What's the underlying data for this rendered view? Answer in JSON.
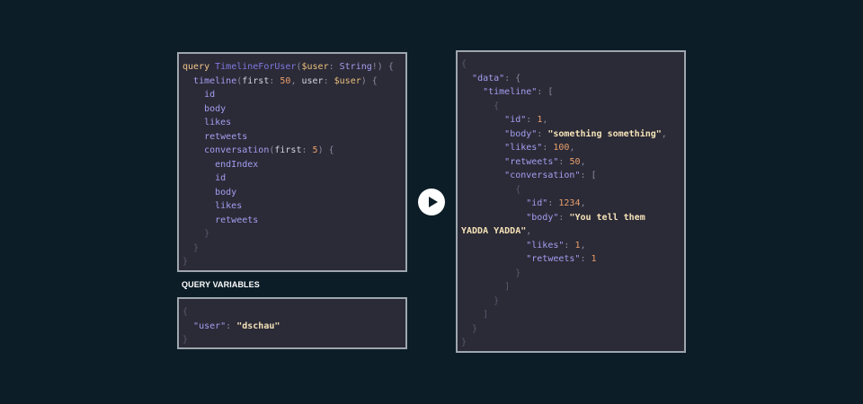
{
  "query": {
    "lines": [
      [
        [
          "kw",
          "query"
        ],
        [
          "plain",
          " "
        ],
        [
          "def",
          "TimelineForUser"
        ],
        [
          "punc",
          "("
        ],
        [
          "var",
          "$user"
        ],
        [
          "punc",
          ": "
        ],
        [
          "type",
          "String"
        ],
        [
          "punc",
          "!) {"
        ]
      ],
      [
        [
          "plain",
          "  "
        ],
        [
          "field",
          "timeline"
        ],
        [
          "punc",
          "("
        ],
        [
          "plain",
          "first"
        ],
        [
          "punc",
          ": "
        ],
        [
          "num",
          "50"
        ],
        [
          "punc",
          ", "
        ],
        [
          "plain",
          "user"
        ],
        [
          "punc",
          ": "
        ],
        [
          "var",
          "$user"
        ],
        [
          "punc",
          ") {"
        ]
      ],
      [
        [
          "plain",
          "    "
        ],
        [
          "field",
          "id"
        ]
      ],
      [
        [
          "plain",
          "    "
        ],
        [
          "field",
          "body"
        ]
      ],
      [
        [
          "plain",
          "    "
        ],
        [
          "field",
          "likes"
        ]
      ],
      [
        [
          "plain",
          "    "
        ],
        [
          "field",
          "retweets"
        ]
      ],
      [
        [
          "plain",
          "    "
        ],
        [
          "field",
          "conversation"
        ],
        [
          "punc",
          "("
        ],
        [
          "plain",
          "first"
        ],
        [
          "punc",
          ": "
        ],
        [
          "num",
          "5"
        ],
        [
          "punc",
          ") {"
        ]
      ],
      [
        [
          "plain",
          "      "
        ],
        [
          "field",
          "endIndex"
        ]
      ],
      [
        [
          "plain",
          "      "
        ],
        [
          "field",
          "id"
        ]
      ],
      [
        [
          "plain",
          "      "
        ],
        [
          "field",
          "body"
        ]
      ],
      [
        [
          "plain",
          "      "
        ],
        [
          "field",
          "likes"
        ]
      ],
      [
        [
          "plain",
          "      "
        ],
        [
          "field",
          "retweets"
        ]
      ],
      [
        [
          "plain",
          "    "
        ],
        [
          "dim",
          "}"
        ]
      ],
      [
        [
          "plain",
          "  "
        ],
        [
          "dim",
          "}"
        ]
      ],
      [
        [
          "dim",
          "}"
        ]
      ]
    ]
  },
  "variables": {
    "label": "QUERY VARIABLES",
    "lines": [
      [
        [
          "dim",
          "{"
        ]
      ],
      [
        [
          "plain",
          "  "
        ],
        [
          "key",
          "\"user\""
        ],
        [
          "punc",
          ": "
        ],
        [
          "str",
          "\"dschau\""
        ]
      ],
      [
        [
          "dim",
          "}"
        ]
      ]
    ]
  },
  "run_button": {
    "icon": "play-icon"
  },
  "result": {
    "lines": [
      [
        [
          "dim",
          "{"
        ]
      ],
      [
        [
          "plain",
          "  "
        ],
        [
          "key",
          "\"data\""
        ],
        [
          "punc",
          ": {"
        ]
      ],
      [
        [
          "plain",
          "    "
        ],
        [
          "key",
          "\"timeline\""
        ],
        [
          "punc",
          ": ["
        ]
      ],
      [
        [
          "plain",
          "      "
        ],
        [
          "dim",
          "{"
        ]
      ],
      [
        [
          "plain",
          "        "
        ],
        [
          "key",
          "\"id\""
        ],
        [
          "punc",
          ": "
        ],
        [
          "num",
          "1"
        ],
        [
          "punc",
          ","
        ]
      ],
      [
        [
          "plain",
          "        "
        ],
        [
          "key",
          "\"body\""
        ],
        [
          "punc",
          ": "
        ],
        [
          "str",
          "\"something something\""
        ],
        [
          "punc",
          ","
        ]
      ],
      [
        [
          "plain",
          "        "
        ],
        [
          "key",
          "\"likes\""
        ],
        [
          "punc",
          ": "
        ],
        [
          "num",
          "100"
        ],
        [
          "punc",
          ","
        ]
      ],
      [
        [
          "plain",
          "        "
        ],
        [
          "key",
          "\"retweets\""
        ],
        [
          "punc",
          ": "
        ],
        [
          "num",
          "50"
        ],
        [
          "punc",
          ","
        ]
      ],
      [
        [
          "plain",
          "        "
        ],
        [
          "key",
          "\"conversation\""
        ],
        [
          "punc",
          ": ["
        ]
      ],
      [
        [
          "plain",
          "          "
        ],
        [
          "dim",
          "{"
        ]
      ],
      [
        [
          "plain",
          "            "
        ],
        [
          "key",
          "\"id\""
        ],
        [
          "punc",
          ": "
        ],
        [
          "num",
          "1234"
        ],
        [
          "punc",
          ","
        ]
      ],
      [
        [
          "plain",
          "            "
        ],
        [
          "key",
          "\"body\""
        ],
        [
          "punc",
          ": "
        ],
        [
          "str",
          "\"You tell them"
        ]
      ],
      [
        [
          "str",
          "YADDA YADDA\""
        ],
        [
          "punc",
          ","
        ]
      ],
      [
        [
          "plain",
          "            "
        ],
        [
          "key",
          "\"likes\""
        ],
        [
          "punc",
          ": "
        ],
        [
          "num",
          "1"
        ],
        [
          "punc",
          ","
        ]
      ],
      [
        [
          "plain",
          "            "
        ],
        [
          "key",
          "\"retweets\""
        ],
        [
          "punc",
          ": "
        ],
        [
          "num",
          "1"
        ]
      ],
      [
        [
          "plain",
          "          "
        ],
        [
          "dim",
          "}"
        ]
      ],
      [
        [
          "plain",
          "        "
        ],
        [
          "dim",
          "]"
        ]
      ],
      [
        [
          "plain",
          "      "
        ],
        [
          "dim",
          "}"
        ]
      ],
      [
        [
          "plain",
          "    "
        ],
        [
          "dim",
          "]"
        ]
      ],
      [
        [
          "plain",
          "  "
        ],
        [
          "dim",
          "}"
        ]
      ],
      [
        [
          "dim",
          "}"
        ]
      ]
    ]
  }
}
